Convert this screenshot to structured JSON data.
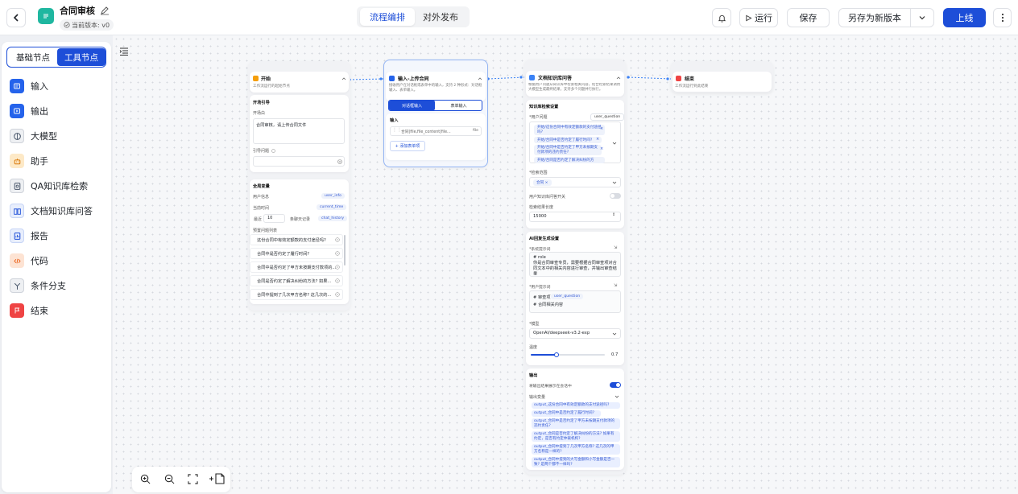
{
  "header": {
    "title": "合同审核",
    "version": "当前版本: v0",
    "tabs": [
      {
        "label": "流程编排",
        "active": true
      },
      {
        "label": "对外发布",
        "active": false
      }
    ],
    "run_label": "运行",
    "save_label": "保存",
    "save_new_label": "另存为新版本",
    "publish_label": "上线"
  },
  "sidebar": {
    "tabs": [
      {
        "label": "基础节点",
        "active": false
      },
      {
        "label": "工具节点",
        "active": true
      }
    ],
    "items": [
      {
        "label": "输入",
        "icon": "input-icon",
        "color": "#2563eb"
      },
      {
        "label": "输出",
        "icon": "output-icon",
        "color": "#2563eb"
      },
      {
        "label": "大模型",
        "icon": "llm-icon",
        "color": "#64748b"
      },
      {
        "label": "助手",
        "icon": "assistant-icon",
        "color": "#f59e0b"
      },
      {
        "label": "QA知识库检索",
        "icon": "qa-icon",
        "color": "#475569"
      },
      {
        "label": "文档知识库问答",
        "icon": "book-icon",
        "color": "#2563eb"
      },
      {
        "label": "报告",
        "icon": "report-icon",
        "color": "#2563eb"
      },
      {
        "label": "代码",
        "icon": "code-icon",
        "color": "#f97316"
      },
      {
        "label": "条件分支",
        "icon": "branch-icon",
        "color": "#475569"
      },
      {
        "label": "结束",
        "icon": "end-icon",
        "color": "#ef4444"
      }
    ]
  },
  "start_node": {
    "title": "开始",
    "desc": "工作流运行的起始节点",
    "guide_section": "开场引导",
    "opening_label": "开场白",
    "opening_text": "合同审核，请上传合同文件",
    "guide_q_label": "引导问题",
    "globals_title": "全局变量",
    "user_info_label": "用户信息",
    "user_info_var": "user_info",
    "time_label": "当前时间",
    "time_var": "current_time",
    "recent_label": "最近",
    "recent_count": "10",
    "recent_suffix": "条聊天记录",
    "history_var": "chat_history",
    "preset_label": "预置问题列表",
    "questions": [
      "这份合同中有效定额款的支付途径吗?",
      "合同中是否约定了履行时间?",
      "合同中是否约定了甲方未按期支付款项的...",
      "合同是否约定了解决纠纷的方法? 如果...",
      "合同中提到了几次甲方名称? 这几次的..."
    ]
  },
  "input_node": {
    "title": "输入-上传合同",
    "desc": "接收用户在对话框或表单中的输入，支持 2 种形式：对话框输入、表单输入。",
    "tab_dialog": "对话框输入",
    "tab_form": "表单输入",
    "section": "输入",
    "var_text": "合同|file,file_content|file...",
    "var_tag": "file",
    "add_label": "+ 添加表单项"
  },
  "doc_node": {
    "title": "文档知识库问答",
    "desc": "根据用户问题从知识库中检索相关内容，结合检索结果调用大模型生成最终结果，支持多个问题并行执行。",
    "kb_section": "知识库检索设置",
    "user_question_label": "*用户问题",
    "user_question_var": "user_question",
    "question_tags": [
      "开始/这份合同中有效定额款的支付途径吗?",
      "开始/合同中是否约定了履行时间?",
      "开始/合同中是否约定了甲方未按期支付款项的违约责任?",
      "开始/合同是否约定了解决纠纷的方"
    ],
    "scope_label": "*检索范围",
    "scope_tag": "合同",
    "user_kb_label": "用户知识库问答开关",
    "length_label": "检索结果长度",
    "length_value": "15000",
    "ai_section": "AI回复生成设置",
    "sys_prompt_label": "*系统提示词",
    "sys_prompt_text": "# role\n你是合同审查专员，需要根据合同审查项对合同文本中的相关内容进行审查，并输出审查结果",
    "user_prompt_label": "*用户提示词",
    "user_prompt_prefix": "# 审查项",
    "user_prompt_var": "user_question",
    "user_prompt_line2": "# 合同相关内容",
    "model_label": "*模型",
    "model_value": "OpenAI/deepseek-v3.2-exp",
    "temp_label": "温度",
    "temp_value": 0.7,
    "output_section": "输出",
    "output_toggle_label": "将输出结果展示在会话中",
    "output_vars_label": "输出变量",
    "output_vars": [
      "output_这份合同中有效定额款的支付途径吗?",
      "output_合同中是否约定了履行时间?",
      "output_合同中是否约定了甲方未按期支付款项的违约责任?",
      "output_合同是否约定了解决纠纷的方法? 如果有约定，是否有约定仲裁机构?",
      "output_合同中提到了几次甲方名称? 这几次的甲方名称是一样的?",
      "output_合同中提到的大写金额和小写金额是否一致? 是两个都不一样吗?"
    ]
  },
  "end_node": {
    "title": "结束",
    "desc": "工作流运行到此结束"
  },
  "colors": {
    "primary": "#1d4ed8",
    "accent_blue": "#2563eb"
  }
}
